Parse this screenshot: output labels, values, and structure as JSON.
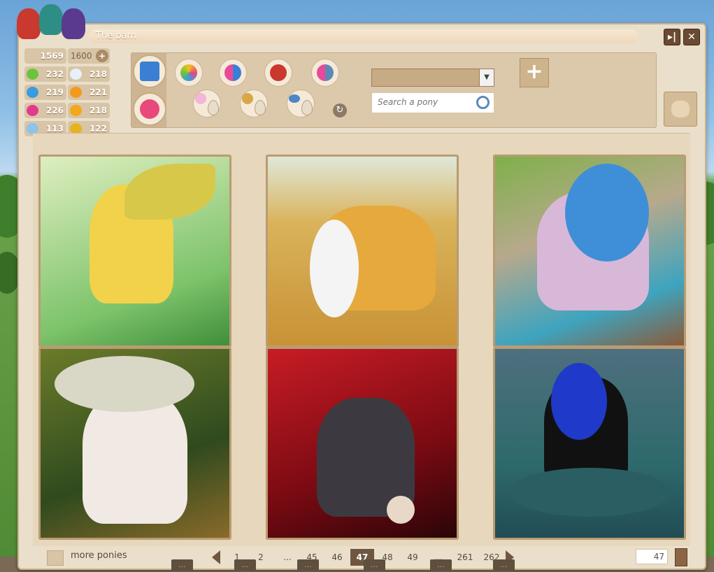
{
  "window": {
    "title": "The barn"
  },
  "stats": {
    "energy": "1569",
    "energy_max": "1600",
    "health": "232",
    "hunger": "218",
    "thirst": "219",
    "fatigue": "221",
    "mood": "226",
    "cleanliness": "218",
    "hygiene": "113",
    "shoes": "122"
  },
  "search": {
    "placeholder": "Search a pony"
  },
  "bottom": {
    "more_label": "more ponies",
    "page_input": "47"
  },
  "pagination": {
    "pages": [
      "1",
      "2",
      "...",
      "45",
      "46",
      "47",
      "48",
      "49",
      "...",
      "261",
      "262"
    ],
    "current": "47"
  },
  "colors": {
    "window_bg": "#eadfca",
    "accent": "#6e5640",
    "sky": "#6aa3d6"
  },
  "background_bar": [
    "...",
    "...",
    "...",
    "...",
    "...",
    "..."
  ]
}
